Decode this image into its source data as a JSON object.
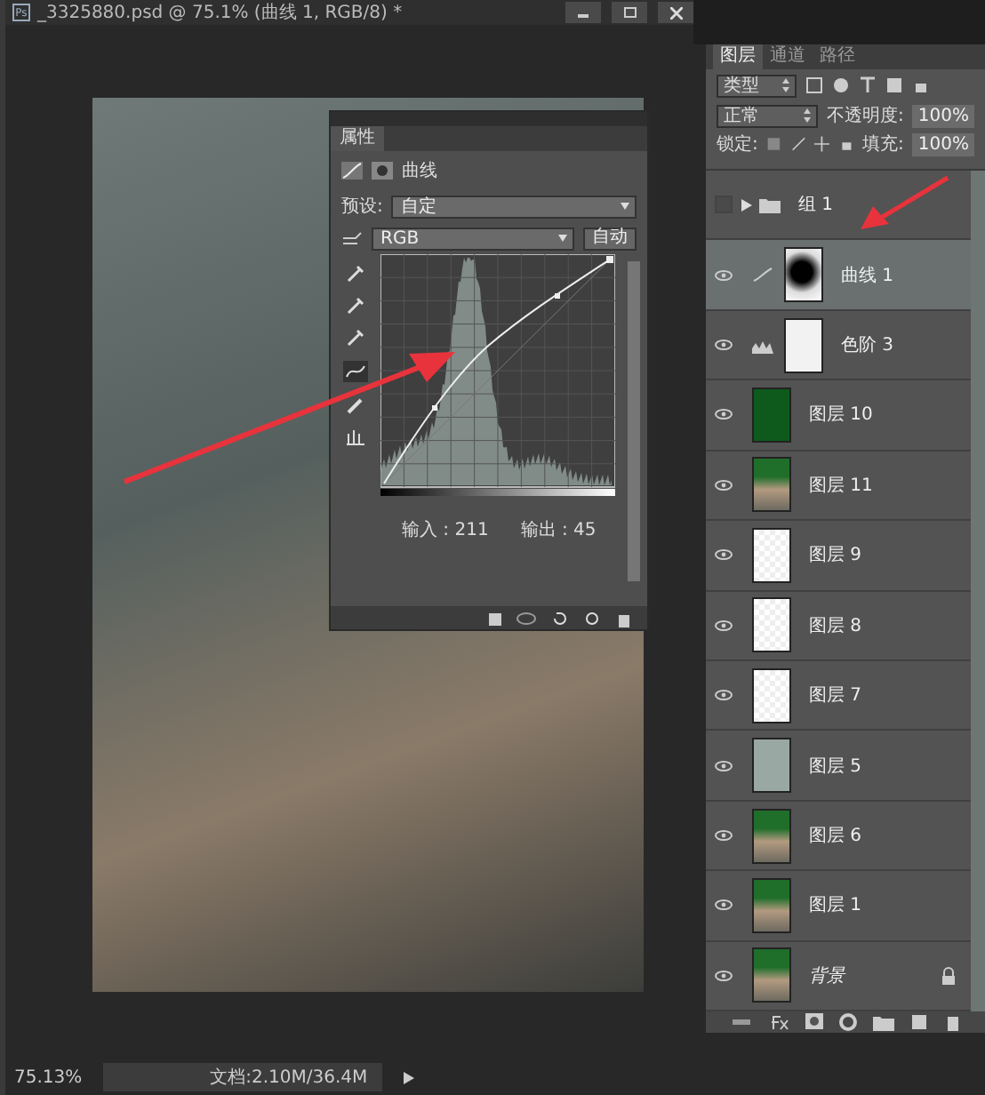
{
  "document": {
    "app_logo": "Ps",
    "title": "_3325880.psd @ 75.1% (曲线 1, RGB/8) *",
    "zoom": "75.13%",
    "doc_size": "文档:2.10M/36.4M"
  },
  "properties": {
    "title": "属性",
    "adjustment": "曲线",
    "preset_label": "预设:",
    "preset": "自定",
    "channel": "RGB",
    "auto_button": "自动",
    "input": "输入 : 211",
    "output": "输出 : 45"
  },
  "layers_panel": {
    "tabs": [
      {
        "label": "图层",
        "selected": true
      },
      {
        "label": "通道",
        "selected": false
      },
      {
        "label": "路径",
        "selected": false
      }
    ],
    "filter": "类型",
    "blend_mode": "正常",
    "opacity_label": "不透明度:",
    "opacity": "100%",
    "lock_label": "锁定:",
    "fill_label": "填充:",
    "fill": "100%",
    "layers": [
      {
        "name": "组 1",
        "kind": "group",
        "visible": false,
        "selected": false,
        "expanded": false
      },
      {
        "name": "曲线 1",
        "kind": "curves",
        "visible": true,
        "selected": true
      },
      {
        "name": "色阶 3",
        "kind": "levels",
        "visible": true,
        "selected": false
      },
      {
        "name": "图层 10",
        "kind": "fill",
        "visible": true,
        "selected": false
      },
      {
        "name": "图层 11",
        "kind": "photo",
        "visible": true,
        "selected": false
      },
      {
        "name": "图层 9",
        "kind": "transparent",
        "visible": true,
        "selected": false
      },
      {
        "name": "图层 8",
        "kind": "transparent",
        "visible": true,
        "selected": false
      },
      {
        "name": "图层 7",
        "kind": "transparent",
        "visible": true,
        "selected": false
      },
      {
        "name": "图层 5",
        "kind": "texture",
        "visible": true,
        "selected": false
      },
      {
        "name": "图层 6",
        "kind": "photo",
        "visible": true,
        "selected": false
      },
      {
        "name": "图层 1",
        "kind": "photo",
        "visible": true,
        "selected": false
      },
      {
        "name": "背景",
        "kind": "background",
        "visible": true,
        "selected": false
      }
    ]
  }
}
